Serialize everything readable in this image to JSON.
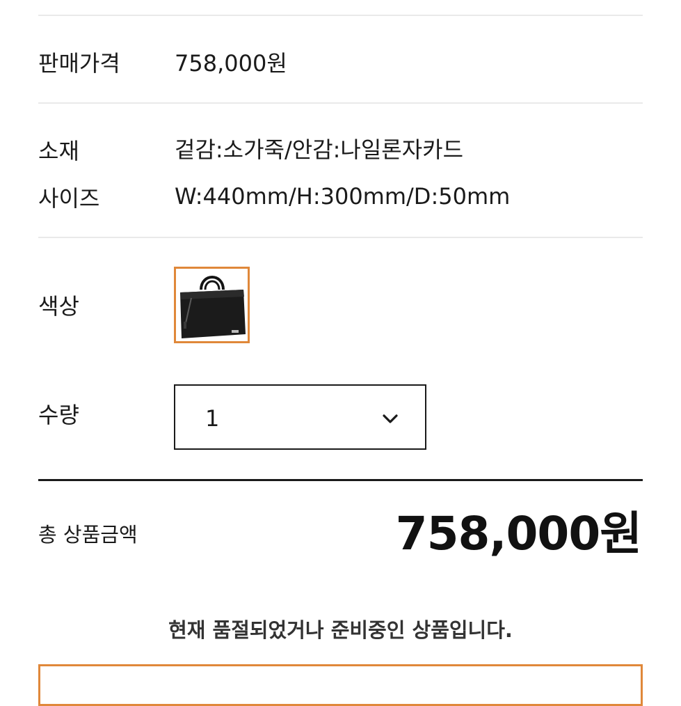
{
  "product_info": {
    "price": {
      "label": "판매가격",
      "value": "758,000원"
    },
    "material": {
      "label": "소재",
      "value": "겉감:소가죽/안감:나일론자카드"
    },
    "size": {
      "label": "사이즈",
      "value": "W:440mm/H:300mm/D:50mm"
    },
    "color": {
      "label": "색상",
      "selected_swatch_icon": "black-briefcase-thumbnail",
      "selected_border_color": "#e0883a"
    },
    "quantity": {
      "label": "수량",
      "selected_value": "1",
      "dropdown_icon": "chevron-down-icon"
    }
  },
  "total": {
    "label": "총 상품금액",
    "value": "758,000원"
  },
  "notice": "현재 품절되었거나 준비중인 상품입니다.",
  "colors": {
    "accent": "#e0883a",
    "text": "#1a1a1a",
    "divider": "#e9e9e9"
  }
}
